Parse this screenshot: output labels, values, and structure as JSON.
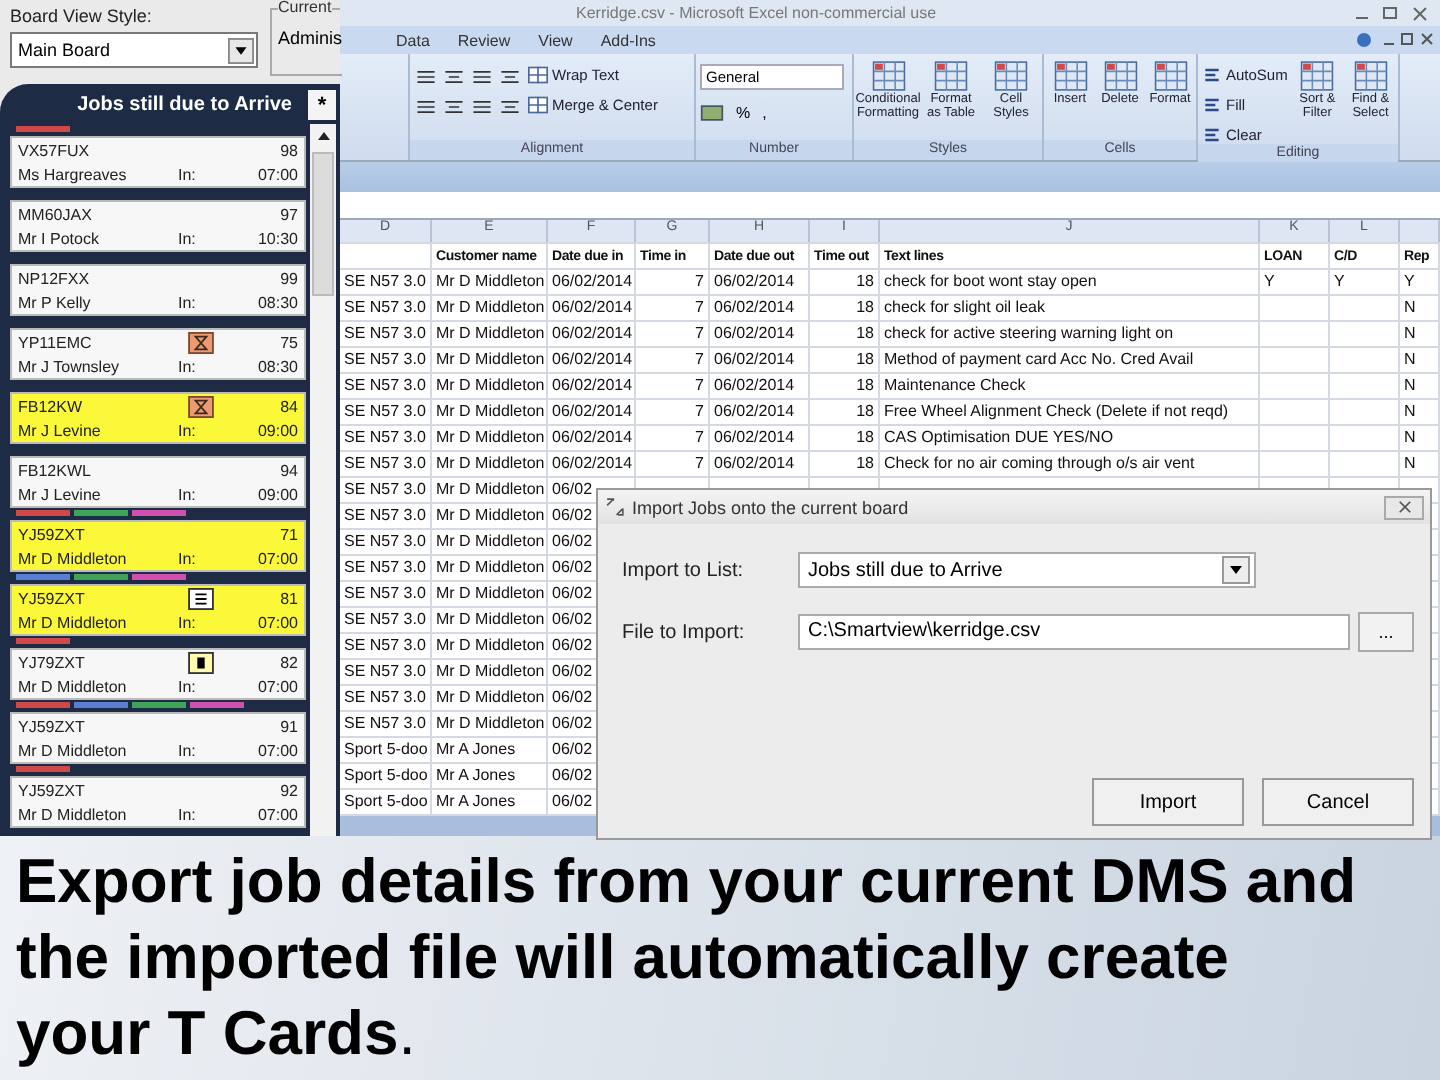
{
  "board": {
    "style_label": "Board View Style:",
    "style_value": "Main Board",
    "current_group": {
      "legend": "Current",
      "value": "Adminis"
    },
    "list_title": "Jobs still due to Arrive",
    "list_tab": "*",
    "cards": [
      {
        "plate": "VX57FUX",
        "number": "98",
        "name": "Ms Hargreaves",
        "in_label": "In:",
        "time": "07:00",
        "highlighted": false,
        "bars": [
          {
            "color": "#d04848"
          }
        ]
      },
      {
        "plate": "MM60JAX",
        "number": "97",
        "name": "Mr I Potock",
        "in_label": "In:",
        "time": "10:30",
        "highlighted": false
      },
      {
        "plate": "NP12FXX",
        "number": "99",
        "name": "Mr P Kelly",
        "in_label": "In:",
        "time": "08:30",
        "highlighted": false
      },
      {
        "plate": "YP11EMC",
        "number": "75",
        "name": "Mr J Townsley",
        "in_label": "In:",
        "time": "08:30",
        "highlighted": false,
        "badge": {
          "kind": "hourglass"
        }
      },
      {
        "plate": "FB12KW",
        "number": "84",
        "name": "Mr J Levine",
        "in_label": "In:",
        "time": "09:00",
        "highlighted": true,
        "badge": {
          "kind": "hourglass"
        }
      },
      {
        "plate": "FB12KWL",
        "number": "94",
        "name": "Mr J Levine",
        "in_label": "In:",
        "time": "09:00",
        "highlighted": false
      },
      {
        "plate": "YJ59ZXT",
        "number": "71",
        "name": "Mr D Middleton",
        "in_label": "In:",
        "time": "07:00",
        "highlighted": true,
        "bars": [
          {
            "color": "#d04848"
          },
          {
            "color": "#3fa35a"
          },
          {
            "color": "#d050b0"
          }
        ]
      },
      {
        "plate": "YJ59ZXT",
        "number": "81",
        "name": "Mr D Middleton",
        "in_label": "In:",
        "time": "07:00",
        "highlighted": true,
        "badge": {
          "kind": "list"
        },
        "bars": [
          {
            "color": "#5a7fd0"
          },
          {
            "color": "#3fa35a"
          },
          {
            "color": "#d050b0"
          }
        ]
      },
      {
        "plate": "YJ79ZXT",
        "number": "82",
        "name": "Mr D Middleton",
        "in_label": "In:",
        "time": "07:00",
        "highlighted": false,
        "badge": {
          "kind": "stop"
        },
        "bars": [
          {
            "color": "#d04848"
          }
        ]
      },
      {
        "plate": "YJ59ZXT",
        "number": "91",
        "name": "Mr D Middleton",
        "in_label": "In:",
        "time": "07:00",
        "highlighted": false,
        "bars": [
          {
            "color": "#d04848"
          },
          {
            "color": "#5a7fd0"
          },
          {
            "color": "#3fa35a"
          },
          {
            "color": "#d050b0"
          }
        ]
      },
      {
        "plate": "YJ59ZXT",
        "number": "92",
        "name": "Mr D Middleton",
        "in_label": "In:",
        "time": "07:00",
        "highlighted": false,
        "bars": [
          {
            "color": "#d04848"
          }
        ]
      }
    ]
  },
  "excel": {
    "title": "Kerridge.csv - Microsoft Excel non-commercial use",
    "tabs": [
      "Data",
      "Review",
      "View",
      "Add-Ins"
    ],
    "ribbon": [
      {
        "kind": "alignment",
        "label": "Alignment",
        "buttons": [
          "Wrap Text",
          "Merge & Center"
        ]
      },
      {
        "kind": "number",
        "label": "Number",
        "format": "General",
        "symbols": [
          "%",
          ","
        ]
      },
      {
        "kind": "large",
        "label": "Styles",
        "buttons": [
          "Conditional Formatting",
          "Format as Table",
          "Cell Styles"
        ]
      },
      {
        "kind": "large",
        "label": "Cells",
        "buttons": [
          "Insert",
          "Delete",
          "Format"
        ]
      },
      {
        "kind": "editing",
        "label": "Editing",
        "small": [
          "AutoSum",
          "Fill",
          "Clear"
        ],
        "buttons": [
          "Sort & Filter",
          "Find & Select"
        ]
      }
    ],
    "column_letters": [
      "D",
      "E",
      "F",
      "G",
      "H",
      "I",
      "J",
      "K",
      "L"
    ],
    "header": [
      "Customer name",
      "Date due in",
      "Time in",
      "Date due out",
      "Time out",
      "Text lines",
      "LOAN",
      "C/D",
      "Rep"
    ],
    "rows": [
      [
        "SE N57 3.0",
        "Mr D Middleton",
        "06/02/2014",
        "7",
        "06/02/2014",
        "18",
        "check for boot wont stay open",
        "Y",
        "Y",
        "Y"
      ],
      [
        "SE N57 3.0",
        "Mr D Middleton",
        "06/02/2014",
        "7",
        "06/02/2014",
        "18",
        "check for slight oil leak",
        "",
        "",
        "N"
      ],
      [
        "SE N57 3.0",
        "Mr D Middleton",
        "06/02/2014",
        "7",
        "06/02/2014",
        "18",
        "check for active steering warning light on",
        "",
        "",
        "N"
      ],
      [
        "SE N57 3.0",
        "Mr D Middleton",
        "06/02/2014",
        "7",
        "06/02/2014",
        "18",
        "Method of payment    card    Acc No.     Cred Avail",
        "",
        "",
        "N"
      ],
      [
        "SE N57 3.0",
        "Mr D Middleton",
        "06/02/2014",
        "7",
        "06/02/2014",
        "18",
        "Maintenance Check",
        "",
        "",
        "N"
      ],
      [
        "SE N57 3.0",
        "Mr D Middleton",
        "06/02/2014",
        "7",
        "06/02/2014",
        "18",
        "Free Wheel Alignment Check (Delete if not reqd)",
        "",
        "",
        "N"
      ],
      [
        "SE N57 3.0",
        "Mr D Middleton",
        "06/02/2014",
        "7",
        "06/02/2014",
        "18",
        "CAS Optimisation DUE YES/NO",
        "",
        "",
        "N"
      ],
      [
        "SE N57 3.0",
        "Mr D Middleton",
        "06/02/2014",
        "7",
        "06/02/2014",
        "18",
        "Check for no air coming through o/s air vent",
        "",
        "",
        "N"
      ],
      [
        "SE N57 3.0",
        "Mr D Middleton",
        "06/02"
      ],
      [
        "SE N57 3.0",
        "Mr D Middleton",
        "06/02"
      ],
      [
        "SE N57 3.0",
        "Mr D Middleton",
        "06/02"
      ],
      [
        "SE N57 3.0",
        "Mr D Middleton",
        "06/02"
      ],
      [
        "SE N57 3.0",
        "Mr D Middleton",
        "06/02"
      ],
      [
        "SE N57 3.0",
        "Mr D Middleton",
        "06/02"
      ],
      [
        "SE N57 3.0",
        "Mr D Middleton",
        "06/02"
      ],
      [
        "SE N57 3.0",
        "Mr D Middleton",
        "06/02"
      ],
      [
        "SE N57 3.0",
        "Mr D Middleton",
        "06/02"
      ],
      [
        "SE N57 3.0",
        "Mr D Middleton",
        "06/02"
      ],
      [
        "Sport 5-doo",
        "Mr A Jones",
        "06/02"
      ],
      [
        "Sport 5-doo",
        "Mr A Jones",
        "06/02"
      ],
      [
        "Sport 5-doo",
        "Mr A Jones",
        "06/02"
      ]
    ]
  },
  "dialog": {
    "title": "Import Jobs onto the current board",
    "list_label": "Import to List:",
    "list_value": "Jobs still due to Arrive",
    "file_label": "File to Import:",
    "file_value": "C:\\Smartview\\kerridge.csv",
    "browse": "...",
    "buttons": [
      "Import",
      "Cancel"
    ]
  },
  "caption": "**Export job details from your current DMS and the imported file will automatically create your T Cards**."
}
